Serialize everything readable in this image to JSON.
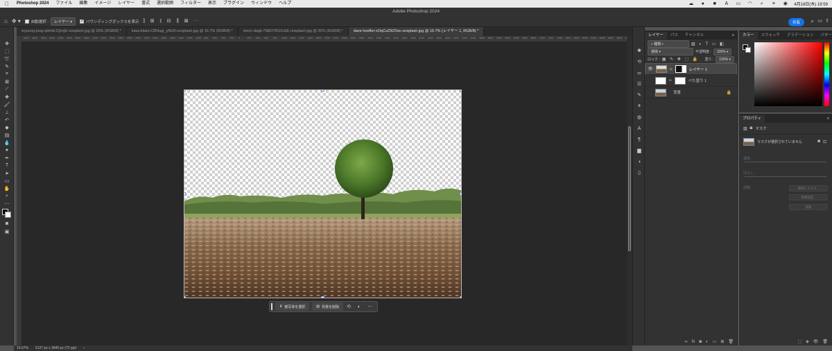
{
  "menubar": {
    "app": "Photoshop 2024",
    "items": [
      "ファイル",
      "編集",
      "イメージ",
      "レイヤー",
      "書式",
      "選択範囲",
      "フィルター",
      "表示",
      "プラグイン",
      "ウィンドウ",
      "ヘルプ"
    ],
    "clock": "4月18日(木)  19:59"
  },
  "window": {
    "title": "Adobe Photoshop 2024"
  },
  "options": {
    "auto_select_label": "自動選択 :",
    "auto_select_value": "レイヤー",
    "bbox_label": "バウンディングボックスを表示",
    "share_label": "共有"
  },
  "tabs": [
    "inyoung-jung-qHmlc1QrnjE-unsplash.jpg @ 25% (RGB/8) *",
    "luisa-kilani-CRHugi_yNU0-unsplash.jpg @ 16.7% (RGB/8) *",
    "meric-dagli-7N8O76GSJsE-unsplash.jpg @ 25% (RGB/8) *",
    "dave-hoefler-xOqCsZ9ZOsc-unsplash.jpg @ 16.7% (レイヤー 1, RGB/8) *"
  ],
  "ruler_ticks": [
    "5000",
    "4800",
    "4600",
    "4400",
    "4200",
    "4000",
    "3800",
    "3600",
    "3400",
    "3200",
    "3000",
    "2800",
    "2600",
    "2400",
    "2200",
    "2000",
    "1800",
    "1600",
    "1400",
    "1200",
    "1000",
    "800",
    "600",
    "400",
    "200",
    "0",
    "200",
    "400",
    "600",
    "800",
    "1000",
    "1200",
    "1400",
    "1600",
    "1800",
    "2000",
    "2200",
    "2400",
    "2600",
    "2800",
    "3000",
    "3200",
    "3400",
    "3600",
    "3800",
    "4000",
    "4200",
    "4400",
    "4600",
    "4800",
    "5000",
    "5200",
    "5400",
    "5600",
    "5800",
    "6000",
    "6200",
    "6400",
    "6600",
    "6800",
    "7000",
    "7200",
    "7400",
    "7600",
    "7800",
    "8000",
    "8200",
    "8400",
    "8600",
    "8800",
    "9000"
  ],
  "context_bar": {
    "select_subject": "被写体を選択",
    "remove_bg": "背景を削除"
  },
  "status": {
    "zoom": "16.67%",
    "doc_size": "5127 px x 3845 px (72 ppi)"
  },
  "layers_panel": {
    "tabs": [
      "レイヤー",
      "パス",
      "チャンネル"
    ],
    "filter_label": "種類",
    "blend_mode": "通常",
    "opacity_label": "不透明度 :",
    "opacity_value": "100%",
    "lock_label": "ロック :",
    "fill_label": "塗り :",
    "fill_value": "100%",
    "layers": [
      {
        "name": "レイヤー 1"
      },
      {
        "name": "べた塗り 1"
      },
      {
        "name": "背景"
      }
    ]
  },
  "color_panel": {
    "tabs": [
      "カラー",
      "スウォッチ",
      "グラデーション",
      "パターン"
    ]
  },
  "properties_panel": {
    "title": "プロパティ",
    "type_label": "マスク",
    "no_mask_msg": "マスクが選択されていません",
    "density_label": "濃度 :",
    "feather_label": "ぼかし :",
    "refine_label": "調整 :",
    "btn_select_mask": "選択とマスク...",
    "btn_color_range": "色域指定...",
    "btn_invert": "反転"
  }
}
